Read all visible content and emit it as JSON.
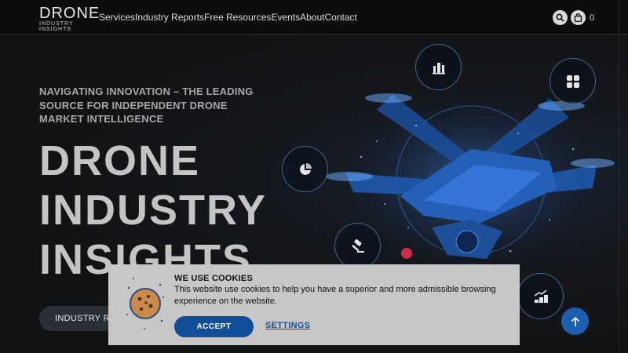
{
  "header": {
    "logo_main": "DRONE",
    "logo_sub": "INDUSTRY INSIGHTS",
    "nav": [
      {
        "label": "Services"
      },
      {
        "label": "Industry Reports"
      },
      {
        "label": "Free Resources"
      },
      {
        "label": "Events"
      },
      {
        "label": "About"
      },
      {
        "label": "Contact"
      }
    ],
    "cart_count": "0",
    "icons": [
      "search-icon",
      "shopping-bag-icon"
    ]
  },
  "hero": {
    "tagline": "NAVIGATING INNOVATION – THE LEADING SOURCE FOR INDEPENDENT DRONE MARKET INTELLIGENCE",
    "headline_lines": [
      "DRONE",
      "INDUSTRY",
      "INSIGHTS"
    ],
    "button_label": "INDUSTRY REPORTS",
    "feature_icons": [
      "building-chart-icon",
      "dashboard-grid-icon",
      "pie-chart-icon",
      "gavel-icon",
      "growth-coins-icon"
    ]
  },
  "cookie_banner": {
    "title": "WE USE COOKIES",
    "text": "This website use cookies to help you have a superior and more admissible browsing experience on the website.",
    "accept_label": "ACCEPT",
    "settings_label": "SETTINGS"
  },
  "colors": {
    "accent": "#114e9a",
    "scroll_top": "#1d5fb0",
    "banner_bg": "#c7c7c7",
    "headline": "#c4c4c4"
  }
}
